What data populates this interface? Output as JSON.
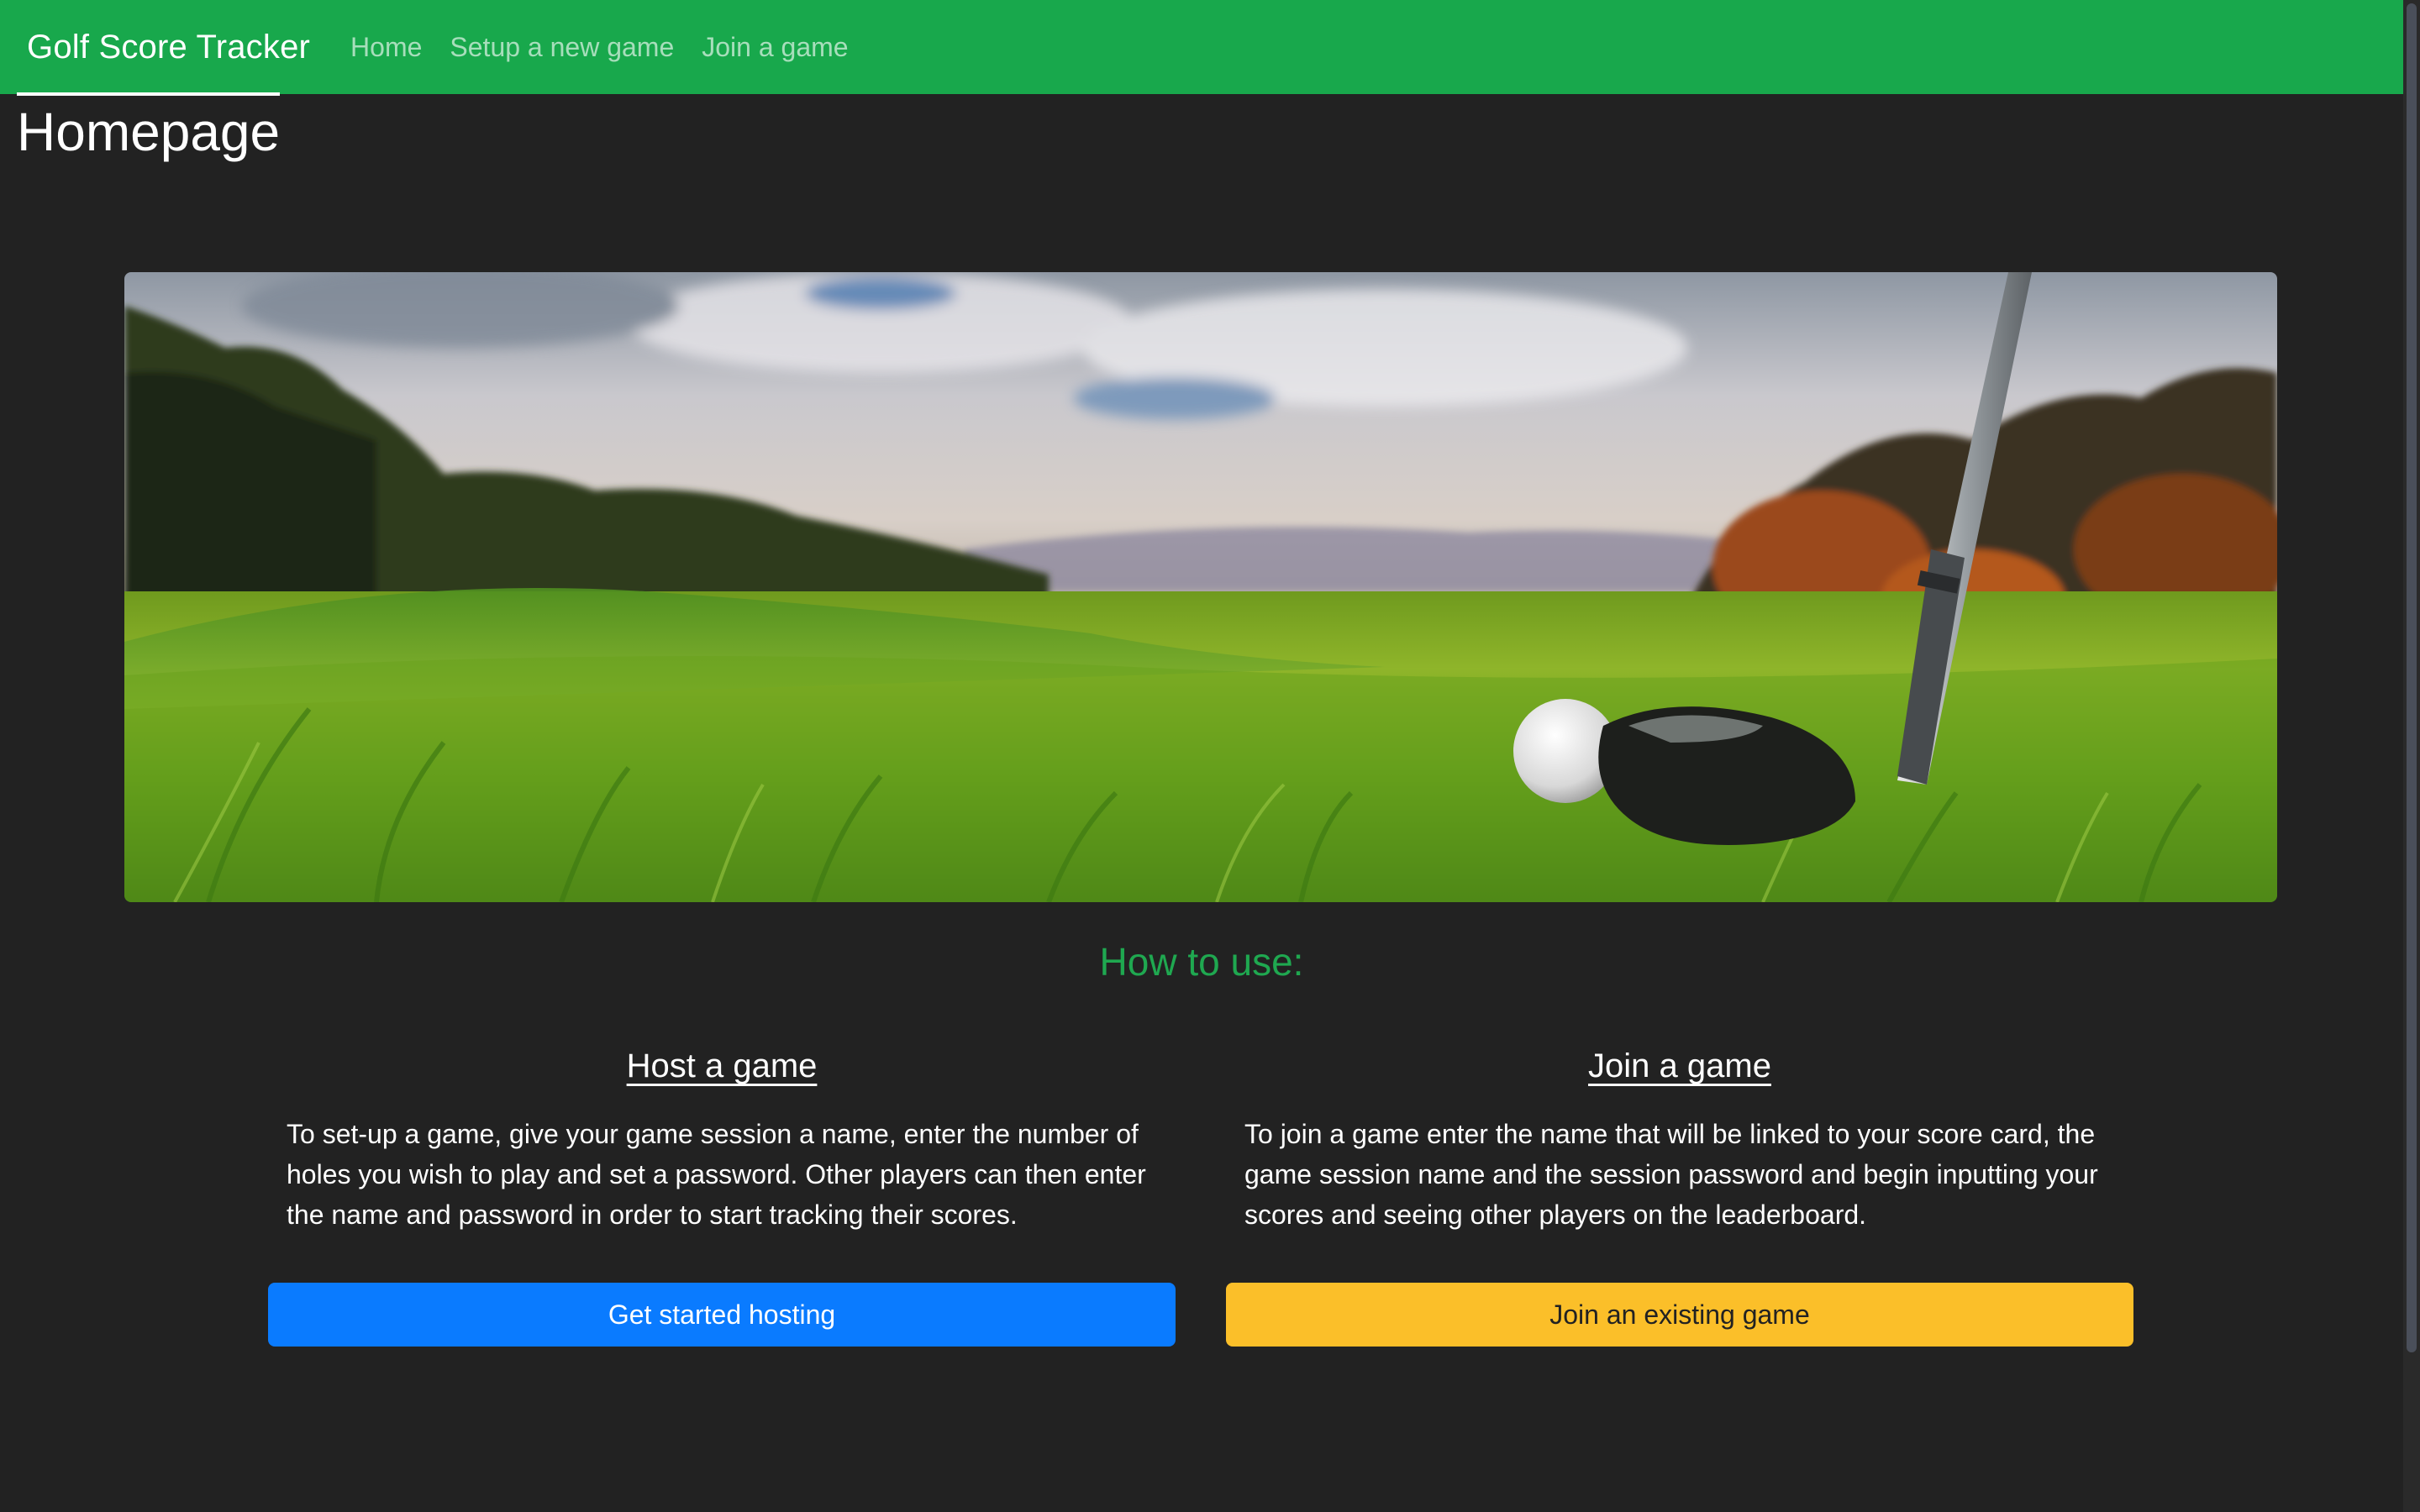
{
  "navbar": {
    "brand": "Golf Score Tracker",
    "links": [
      "Home",
      "Setup a new game",
      "Join a game"
    ],
    "color": "#18a84c"
  },
  "page": {
    "title": "Homepage",
    "background": "#222222"
  },
  "hero": {
    "image": "golf-course-club-ball-photo"
  },
  "how_to": {
    "heading": "How to use:",
    "host": {
      "title": "Host a game",
      "text": "To set-up a game, give your game session a name, enter the number of holes you wish to play and set a password. Other players can then enter the name and password in order to start tracking their scores.",
      "button": "Get started hosting",
      "button_color": "#0a7bff"
    },
    "join": {
      "title": "Join a game",
      "text": "To join a game enter the name that will be linked to your score card, the game session name and the session password and begin inputting your scores and seeing other players on the leaderboard.",
      "button": "Join an existing game",
      "button_color": "#fbbf29"
    }
  }
}
